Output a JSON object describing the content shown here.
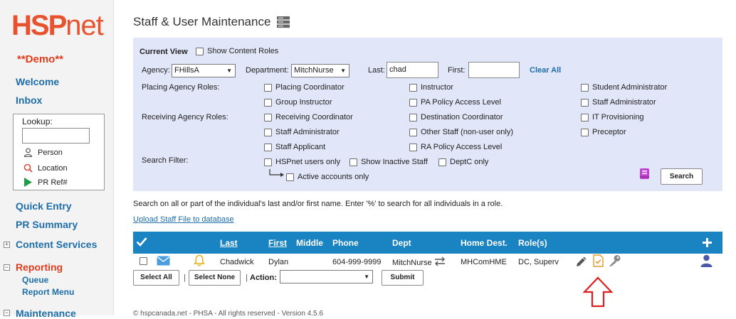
{
  "brand": {
    "logo_main": "HSP",
    "logo_net": "net",
    "mode": "**Demo**"
  },
  "sidebar": {
    "welcome": "Welcome",
    "inbox": "Inbox",
    "lookup": {
      "title": "Lookup:",
      "person": "Person",
      "location": "Location",
      "pr_ref": "PR Ref#"
    },
    "quick_entry": "Quick Entry",
    "pr_summary": "PR Summary",
    "content_services": "Content Services",
    "reporting": "Reporting",
    "queue": "Queue",
    "report_menu": "Report Menu",
    "maintenance": "Maintenance"
  },
  "page": {
    "title": "Staff & User Maintenance"
  },
  "filters": {
    "current_view": "Current View",
    "show_content_roles": "Show Content Roles",
    "agency_label": "Agency:",
    "agency_value": "FHillsA",
    "department_label": "Department:",
    "department_value": "MitchNurse",
    "last_label": "Last:",
    "last_value": "chad",
    "first_label": "First:",
    "first_value": "",
    "clear_all": "Clear All",
    "placing_roles_label": "Placing Agency Roles:",
    "receiving_roles_label": "Receiving Agency Roles:",
    "search_filter_label": "Search Filter:",
    "roles_col1": [
      "Placing Coordinator",
      "Group Instructor",
      "Receiving Coordinator",
      "Staff Administrator",
      "Staff Applicant"
    ],
    "roles_col2": [
      "Instructor",
      "PA Policy Access Level",
      "Destination Coordinator",
      "Other Staff (non-user only)",
      "RA Policy Access Level"
    ],
    "roles_col3": [
      "Student Administrator",
      "Staff Administrator",
      "IT Provisioning",
      "Preceptor"
    ],
    "hspnet_only": "HSPnet users only",
    "show_inactive": "Show Inactive Staff",
    "deptc_only": "DeptC only",
    "active_only": "Active accounts only",
    "search_button": "Search"
  },
  "info_text": "Search on all or part of the individual's last and/or first name. Enter '%' to search for all individuals in a role.",
  "upload_link": "Upload Staff File to database",
  "table": {
    "headers": {
      "last": "Last",
      "first": "First",
      "middle": "Middle",
      "phone": "Phone",
      "dept": "Dept",
      "home_dest": "Home Dest.",
      "roles": "Role(s)"
    },
    "row": {
      "last": "Chadwick",
      "first": "Dylan",
      "middle": "",
      "phone": "604-999-9999",
      "dept": "MitchNurse",
      "home_dest": "MHComHME",
      "roles": "DC, Superv"
    }
  },
  "actions": {
    "select_all": "Select All",
    "select_none": "Select None",
    "action_label": "Action:",
    "action_value": "",
    "submit": "Submit"
  },
  "footer": "© hspcanada.net - PHSA - All rights reserved - Version 4.5.6",
  "colors": {
    "brand": "#e8532f",
    "link": "#1d6ea8",
    "panel": "#e1e6f8",
    "table_header": "#1a83c2",
    "annotation_arrow": "#e02020"
  }
}
